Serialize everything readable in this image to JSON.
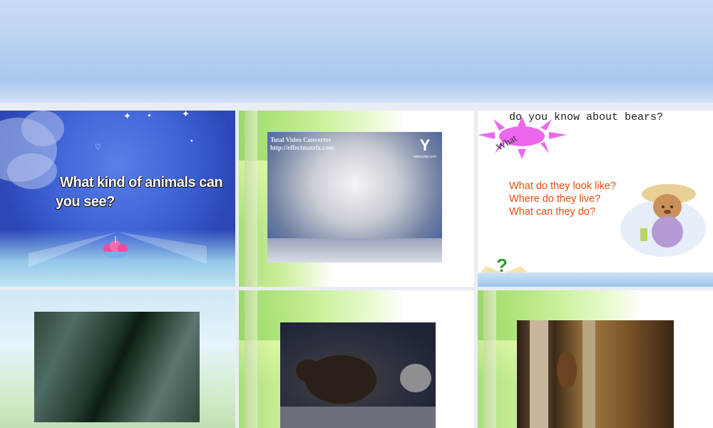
{
  "slides": {
    "s1": {
      "question_line1": "What kind of animals can",
      "question_line2": "you see?"
    },
    "s2": {
      "watermark_line1": "Total Video Converter",
      "watermark_line2": "http://effectmatrix.com",
      "logo_text": "Y",
      "logo_sub": "www.yxtp.com"
    },
    "s3": {
      "title": "do you know about bears?",
      "what_label": "What",
      "questions": [
        "What do they look like?",
        "Where do they live?",
        "What can they do?"
      ]
    }
  },
  "colors": {
    "question_red": "#e64b10",
    "sun_pink": "#ee66ee"
  }
}
